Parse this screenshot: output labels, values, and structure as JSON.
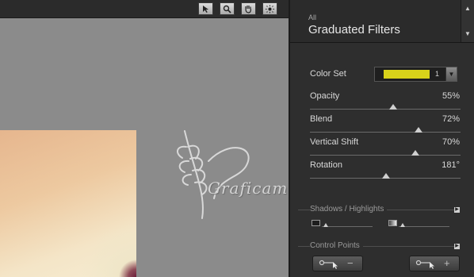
{
  "toolbar": {
    "tools": [
      "select-arrow-icon",
      "zoom-icon",
      "hand-pan-icon",
      "spot-light-icon"
    ]
  },
  "watermark": {
    "text": "Graficamia"
  },
  "panel": {
    "category": "All",
    "title": "Graduated Filters",
    "color_set": {
      "label": "Color Set",
      "value": "1",
      "swatch_color": "#d8d21a"
    },
    "sliders": [
      {
        "label": "Opacity",
        "value": "55%",
        "level": 0.55
      },
      {
        "label": "Blend",
        "value": "72%",
        "level": 0.72
      },
      {
        "label": "Vertical Shift",
        "value": "70%",
        "level": 0.7
      },
      {
        "label": "Rotation",
        "value": "181°",
        "level": 0.503
      }
    ],
    "shadows_highlights": {
      "label": "Shadows / Highlights"
    },
    "control_points": {
      "label": "Control Points",
      "minus": "−",
      "plus": "+"
    }
  }
}
